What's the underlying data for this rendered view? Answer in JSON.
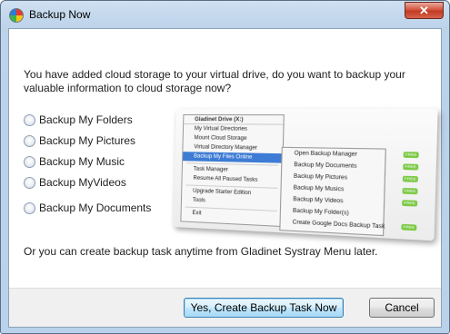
{
  "window": {
    "title": "Backup Now",
    "close_symbol": "✕"
  },
  "question": "You have added cloud storage to your virtual drive, do you want to backup your valuable information to cloud storage now?",
  "options": [
    {
      "label": "Backup My Folders"
    },
    {
      "label": "Backup My Pictures"
    },
    {
      "label": "Backup My Music"
    },
    {
      "label": "Backup MyVideos"
    },
    {
      "label": "Backup My Documents"
    }
  ],
  "illustration": {
    "menu_header": "Gladinet Drive (X:)",
    "menu_items": [
      "My Virtual Directories",
      "Mount Cloud Storage",
      "Virtual Directory Manager",
      "Backup My Files Online",
      "Task Manager",
      "Resume All Paused Tasks",
      "Upgrade Starter Edition",
      "Tools",
      "Exit"
    ],
    "submenu_items": [
      "Open Backup Manager",
      "Backup My Documents",
      "Backup My Pictures",
      "Backup My Musics",
      "Backup My Videos",
      "Backup My Folder(s)",
      "Create Google Docs Backup Task"
    ],
    "badge_text": "FREE"
  },
  "footnote": "Or you can create backup task anytime from Gladinet Systray Menu later.",
  "buttons": {
    "create": "Yes, Create Backup Task Now",
    "cancel": "Cancel"
  },
  "colors": {
    "titlebar": "#bcd3ea",
    "close_button": "#c23a23",
    "highlight": "#3d7bd4"
  }
}
